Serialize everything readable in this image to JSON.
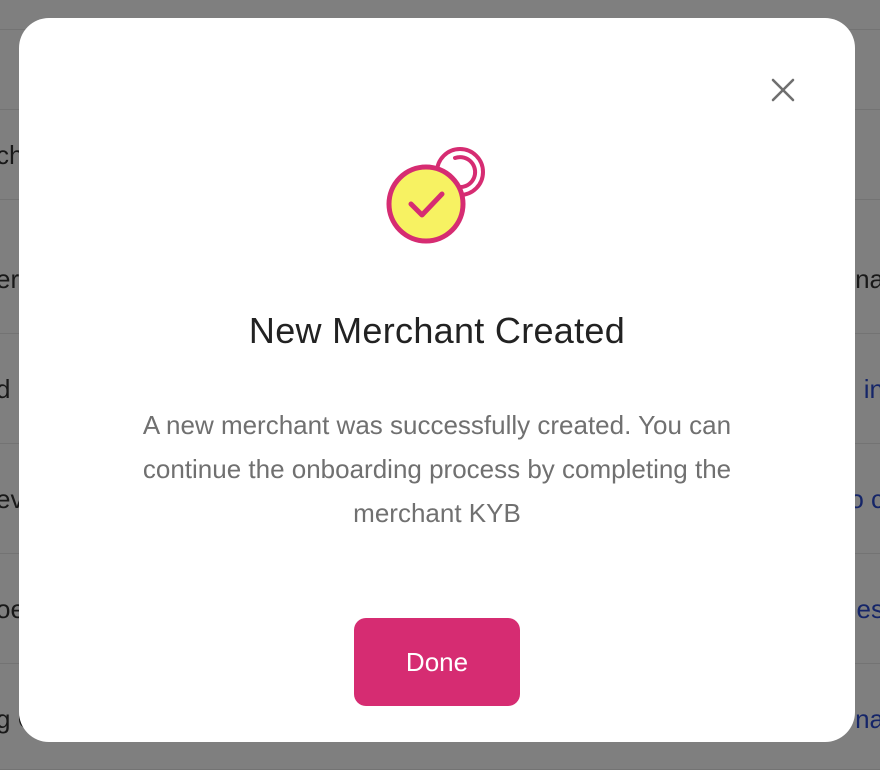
{
  "background": {
    "rows": [
      {
        "left": "",
        "right": ""
      },
      {
        "left": "ch",
        "right": ""
      },
      {
        "left": "er",
        "right": "na"
      },
      {
        "left": "d",
        "right": "in"
      },
      {
        "left": "ev",
        "right": "o c"
      },
      {
        "left": "oe",
        "right": "es"
      },
      {
        "left": "g C",
        "right": "na"
      }
    ]
  },
  "modal": {
    "close_icon": "close-icon",
    "success_icon": "check-badge-icon",
    "title": "New Merchant Created",
    "message": "A new merchant was successfully created. You can continue the onboarding process by completing the merchant KYB",
    "done_label": "Done"
  },
  "colors": {
    "accent": "#d62c72",
    "icon_fill": "#f7f262",
    "icon_stroke": "#d62c72",
    "overlay": "rgba(0,0,0,0.5)"
  }
}
